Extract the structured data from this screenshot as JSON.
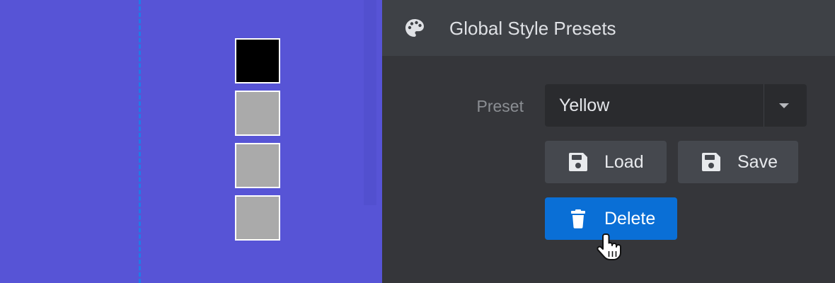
{
  "canvas": {
    "background_color": "#5754d6",
    "guide_line_color": "#1f7ce8",
    "swatches": [
      {
        "name": "swatch-black",
        "color": "#000000"
      },
      {
        "name": "swatch-gray-1",
        "color": "#aaaaaa"
      },
      {
        "name": "swatch-gray-2",
        "color": "#aaaaaa"
      },
      {
        "name": "swatch-gray-3",
        "color": "#aaaaaa"
      }
    ]
  },
  "panel": {
    "title": "Global Style Presets",
    "title_icon": "palette-icon",
    "preset_label": "Preset",
    "preset_select": {
      "value": "Yellow",
      "icon": "chevron-down-icon"
    },
    "buttons": {
      "load_label": "Load",
      "load_icon": "floppy-disk-icon",
      "save_label": "Save",
      "save_icon": "floppy-disk-icon",
      "delete_label": "Delete",
      "delete_icon": "trash-icon"
    },
    "colors": {
      "panel_bg": "#35363a",
      "header_bg": "#3e4146",
      "button_bg": "#45484e",
      "delete_accent": "#0a6fd6"
    }
  },
  "cursor": {
    "type": "hand-pointer-cursor"
  }
}
